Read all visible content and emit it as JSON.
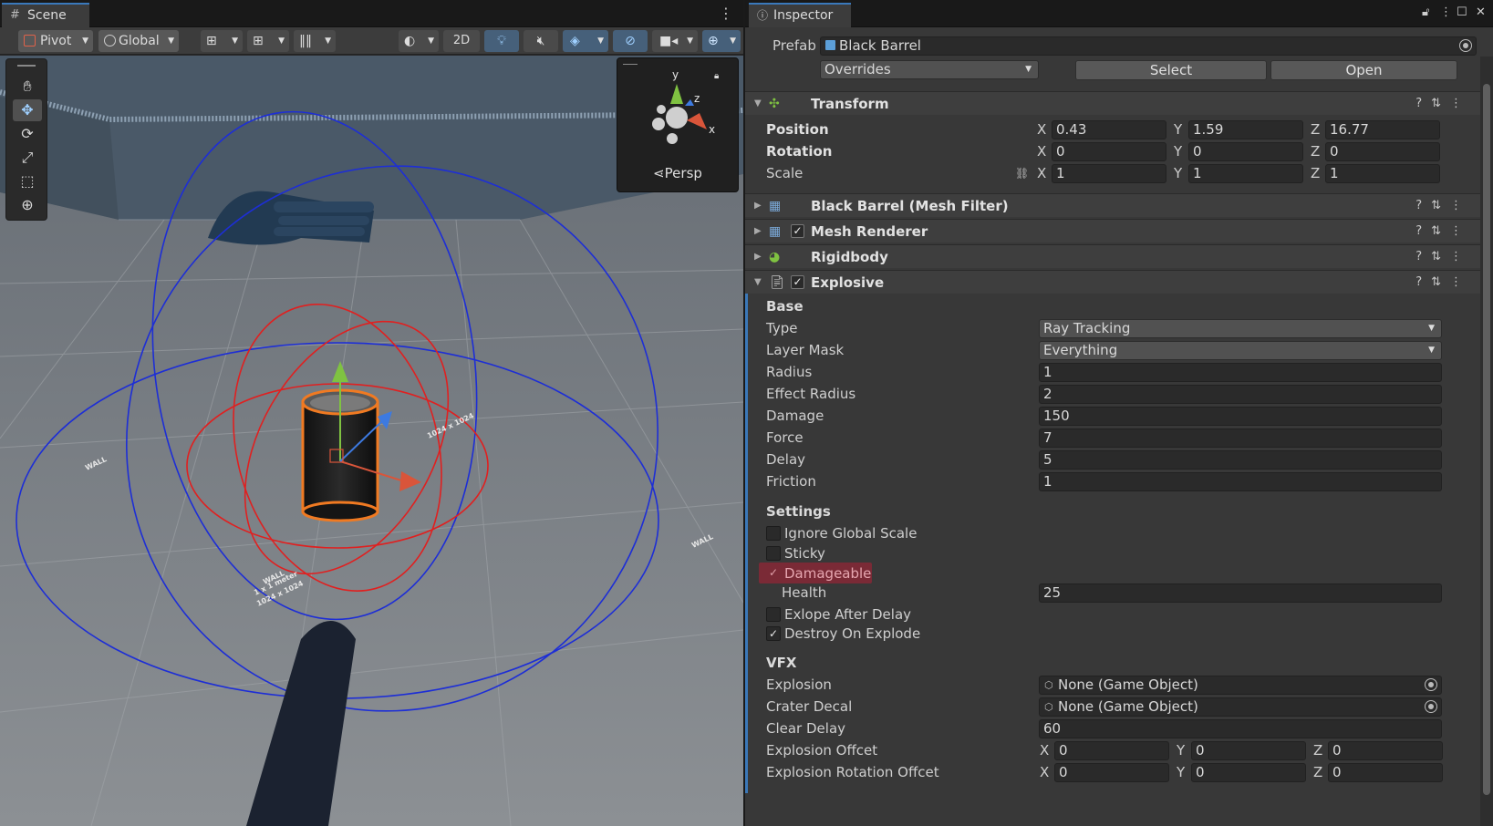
{
  "scene": {
    "tab_label": "Scene",
    "toolbar": {
      "pivot_label": "Pivot",
      "global_label": "Global",
      "twod_label": "2D"
    },
    "tools": [
      "hand-tool",
      "move-tool",
      "rotate-tool",
      "scale-tool",
      "rect-tool",
      "transform-tool"
    ],
    "gizmo": {
      "y_label": "y",
      "z_label": "z",
      "x_label": "x",
      "projection_label": "Persp",
      "projection_glyph": "⋖"
    },
    "floor_labels": [
      "WALL",
      "1 x 1 meter",
      "1024 x 1024"
    ]
  },
  "inspector": {
    "tab_label": "Inspector",
    "prefab": {
      "label": "Prefab",
      "value": "Black Barrel",
      "overrides_label": "Overrides",
      "select_label": "Select",
      "open_label": "Open"
    },
    "transform": {
      "title": "Transform",
      "position_label": "Position",
      "rotation_label": "Rotation",
      "scale_label": "Scale",
      "position": {
        "x": "0.43",
        "y": "1.59",
        "z": "16.77"
      },
      "rotation": {
        "x": "0",
        "y": "0",
        "z": "0"
      },
      "scale": {
        "x": "1",
        "y": "1",
        "z": "1"
      },
      "axis_x": "X",
      "axis_y": "Y",
      "axis_z": "Z"
    },
    "components": {
      "mesh_filter": "Black Barrel (Mesh Filter)",
      "mesh_renderer": "Mesh Renderer",
      "rigidbody": "Rigidbody",
      "explosive": "Explosive"
    },
    "explosive": {
      "base_header": "Base",
      "type_label": "Type",
      "type_value": "Ray Tracking",
      "layer_mask_label": "Layer Mask",
      "layer_mask_value": "Everything",
      "radius_label": "Radius",
      "radius_value": "1",
      "effect_radius_label": "Effect Radius",
      "effect_radius_value": "2",
      "damage_label": "Damage",
      "damage_value": "150",
      "force_label": "Force",
      "force_value": "7",
      "delay_label": "Delay",
      "delay_value": "5",
      "friction_label": "Friction",
      "friction_value": "1",
      "settings_header": "Settings",
      "ignore_global_scale_label": "Ignore Global Scale",
      "sticky_label": "Sticky",
      "damageable_label": "Damageable",
      "health_label": "Health",
      "health_value": "25",
      "explode_after_delay_label": "Exlope After Delay",
      "destroy_on_explode_label": "Destroy On Explode",
      "vfx_header": "VFX",
      "explosion_label": "Explosion",
      "explosion_value": "None (Game Object)",
      "crater_decal_label": "Crater Decal",
      "crater_decal_value": "None (Game Object)",
      "clear_delay_label": "Clear Delay",
      "clear_delay_value": "60",
      "explosion_offset_label": "Explosion Offcet",
      "explosion_offset": {
        "x": "0",
        "y": "0",
        "z": "0"
      },
      "explosion_rotation_offset_label": "Explosion Rotation Offcet",
      "explosion_rotation_offset": {
        "x": "0",
        "y": "0",
        "z": "0"
      }
    },
    "checkbox_states": {
      "mesh_renderer": true,
      "explosive": true,
      "ignore_global_scale": false,
      "sticky": false,
      "damageable": true,
      "explode_after_delay": false,
      "destroy_on_explode": true
    },
    "check_glyph": "✓"
  },
  "colors": {
    "accent_blue": "#3a79bb",
    "highlight_red": "#7a2a36",
    "gizmo_y": "#7fc241",
    "gizmo_x": "#d9553a",
    "gizmo_z": "#3d7ae0"
  }
}
